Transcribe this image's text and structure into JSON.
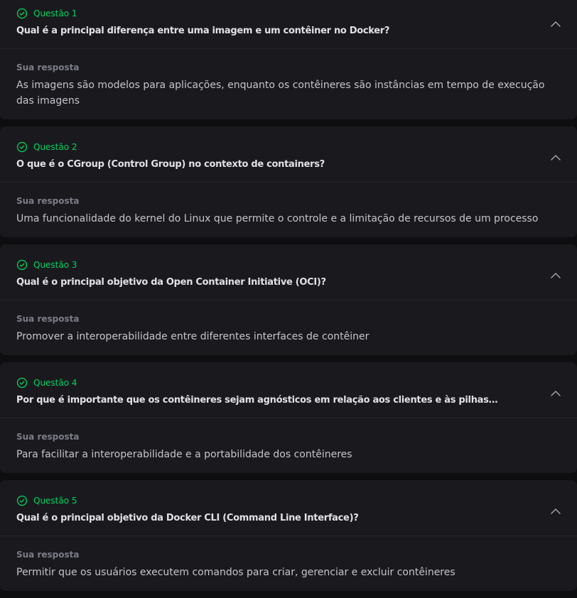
{
  "answer_label": "Sua resposta",
  "colors": {
    "accent": "#04d361",
    "card_bg": "#1a1a1e",
    "page_bg": "#0e0e10"
  },
  "icons": {
    "status": "check-circle-icon",
    "toggle": "chevron-up-icon"
  },
  "questions": [
    {
      "label": "Questão 1",
      "title": "Qual é a principal diferença entre uma imagem e um contêiner no Docker?",
      "answer": "As imagens são modelos para aplicações, enquanto os contêineres são instâncias em tempo de execução das imagens"
    },
    {
      "label": "Questão 2",
      "title": "O que é o CGroup (Control Group) no contexto de containers?",
      "answer": "Uma funcionalidade do kernel do Linux que permite o controle e a limitação de recursos de um processo"
    },
    {
      "label": "Questão 3",
      "title": "Qual é o principal objetivo da Open Container Initiative (OCI)?",
      "answer": "Promover a interoperabilidade entre diferentes interfaces de contêiner"
    },
    {
      "label": "Questão 4",
      "title": "Por que é importante que os contêineres sejam agnósticos em relação aos clientes e às pilhas de…",
      "answer": "Para facilitar a interoperabilidade e a portabilidade dos contêineres"
    },
    {
      "label": "Questão 5",
      "title": "Qual é o principal objetivo da Docker CLI (Command Line Interface)?",
      "answer": "Permitir que os usuários executem comandos para criar, gerenciar e excluir contêineres"
    }
  ]
}
